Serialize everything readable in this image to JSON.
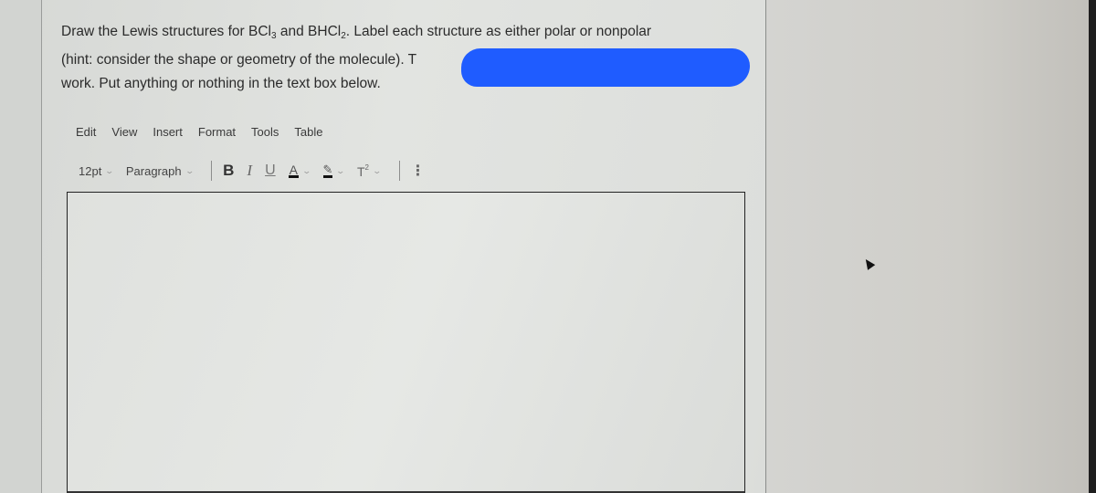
{
  "question": {
    "line1_pre": "Draw the Lewis structures for BCl",
    "line1_sub1": "3",
    "line1_mid": " and BHCl",
    "line1_sub2": "2",
    "line1_post": ".  Label each structure as either polar or nonpolar",
    "line2": "(hint: consider the shape or geometry of the molecule).  T",
    "line3": "work.  Put anything or nothing in the text box below."
  },
  "redaction_color": "#1f5cff",
  "menubar": {
    "items": [
      "Edit",
      "View",
      "Insert",
      "Format",
      "Tools",
      "Table"
    ]
  },
  "toolbar": {
    "font_size": "12pt",
    "block_format": "Paragraph",
    "bold_label": "B",
    "italic_label": "I",
    "underline_label": "U",
    "font_color_label": "A",
    "highlight_label": "✎",
    "superscript_label": "T",
    "superscript_mark": "2",
    "more_label": "⋮",
    "chevron": "⌄"
  },
  "editor": {
    "content": ""
  }
}
